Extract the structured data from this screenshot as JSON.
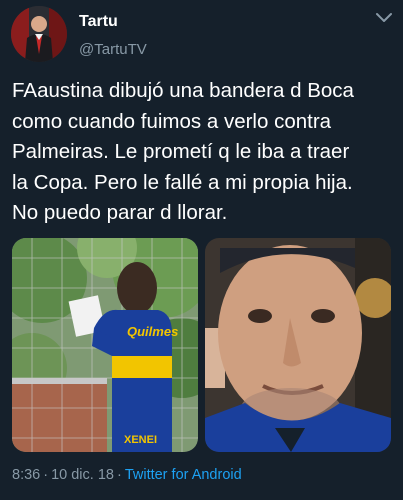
{
  "author": {
    "display_name": "Tartu",
    "handle": "@TartuTV"
  },
  "tweet": {
    "text": "FAaustina dibujó una bandera d Boca\ncomo cuando fuimos a verlo contra\nPalmeiras. Le prometí q le iba a traer\nla Copa. Pero le fallé a mi propia hija.\nNo puedo parar d llorar.",
    "time": "8:36",
    "separator": "·",
    "date": "10 dic. 18",
    "app": "Twitter for Android"
  },
  "photos": {
    "left_shirt_text": "Quilmes",
    "left_sleeve_text": "XENEI"
  },
  "colors": {
    "background": "#15202b",
    "link": "#1da1f2",
    "secondary_text": "#8899a6",
    "boca_blue": "#1a3f9c",
    "boca_yellow": "#f2c500"
  },
  "icons": {
    "menu": "chevron-down-icon"
  }
}
